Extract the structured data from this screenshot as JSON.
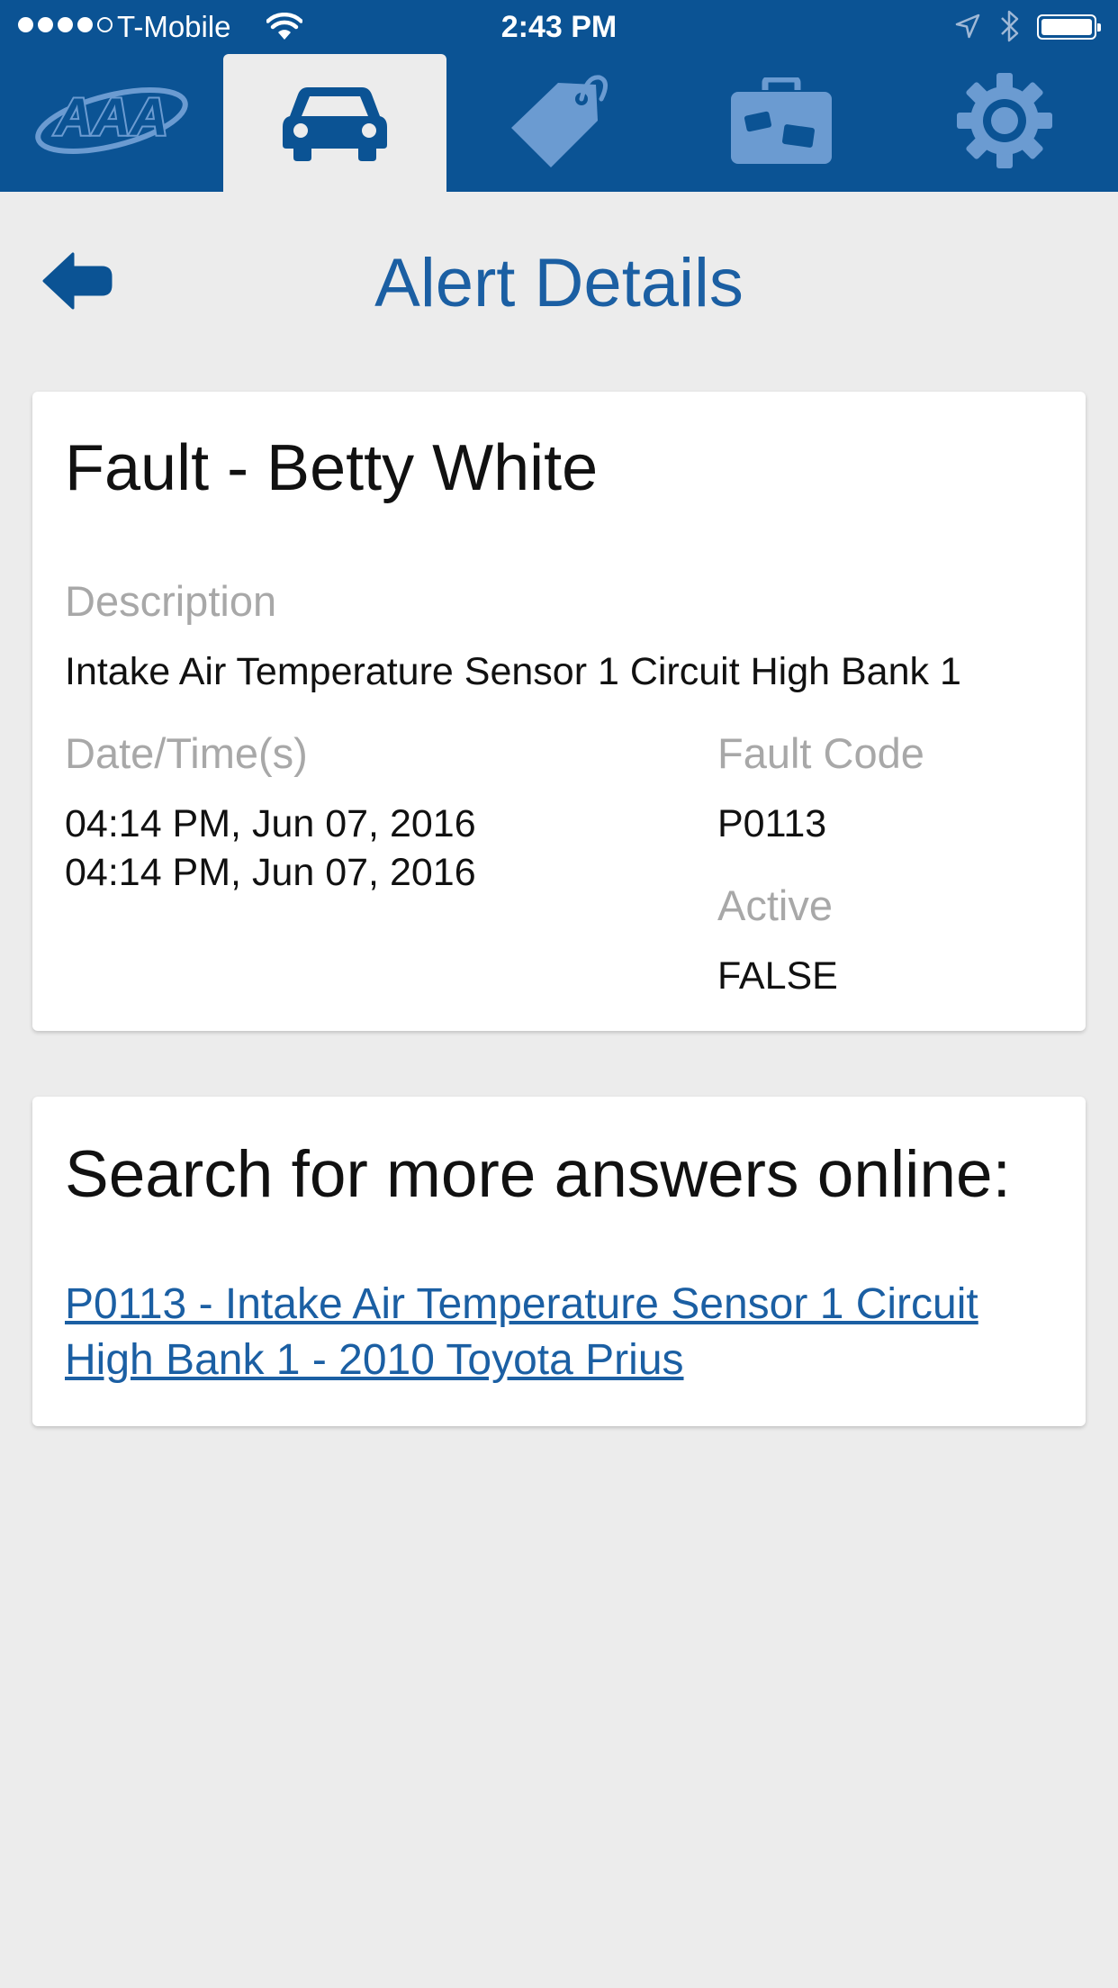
{
  "status_bar": {
    "carrier": "T-Mobile",
    "time": "2:43 PM",
    "signal_bars": 4,
    "signal_total": 5
  },
  "tabs": [
    {
      "name": "aaa-logo",
      "icon": "aaa-logo-icon",
      "active": false,
      "logo_text": "AAA"
    },
    {
      "name": "vehicle",
      "icon": "car-icon",
      "active": true
    },
    {
      "name": "discounts",
      "icon": "tag-icon",
      "active": false
    },
    {
      "name": "travel",
      "icon": "suitcase-icon",
      "active": false
    },
    {
      "name": "settings",
      "icon": "gear-icon",
      "active": false
    }
  ],
  "page": {
    "title": "Alert Details",
    "back_icon": "back-arrow-icon"
  },
  "fault_card": {
    "title": "Fault - Betty White",
    "description_label": "Description",
    "description": "Intake Air Temperature Sensor 1 Circuit High Bank 1",
    "datetime_label": "Date/Time(s)",
    "datetimes": [
      "04:14 PM, Jun 07, 2016",
      "04:14 PM, Jun 07, 2016"
    ],
    "fault_code_label": "Fault Code",
    "fault_code": "P0113",
    "active_label": "Active",
    "active": "FALSE"
  },
  "search_card": {
    "title": "Search for more answers online:",
    "link_text": "P0113 - Intake Air Temperature Sensor 1 Circuit High Bank 1  - 2010 Toyota Prius"
  },
  "colors": {
    "header_bg": "#0b5394",
    "tab_icon": "#6b9bd1",
    "active_icon": "#0b5394",
    "title": "#1b5fa3",
    "page_bg": "#ececec",
    "label": "#a8a8a8"
  }
}
